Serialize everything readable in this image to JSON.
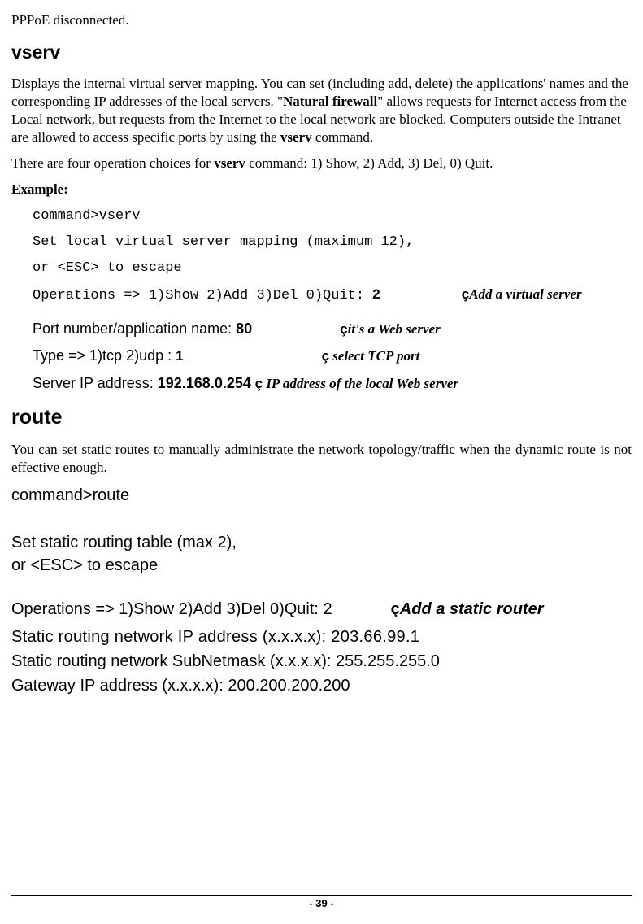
{
  "top_line": "PPPoE disconnected.",
  "vserv": {
    "heading": "vserv",
    "p1_1": "Displays the internal virtual server mapping. You can set (including add, delete) the applications' names and the corresponding IP addresses of the local servers.  \"",
    "p1_bold1": "Natural firewall",
    "p1_2": "\" allows requests for Internet access from the Local network, but requests from the Internet to the local network are blocked. Computers outside the Intranet are allowed to access specific ports by using the ",
    "p1_bold2": "vserv",
    "p1_3": " command.",
    "p2_1": "There are four operation choices for ",
    "p2_bold": "vserv",
    "p2_2": " command: 1) Show, 2) Add, 3) Del, 0) Quit.",
    "example_label": "Example:",
    "l1": "command>vserv",
    "l2": "Set local virtual server mapping (maximum 12),",
    "l3": "or <ESC> to escape",
    "l4_a": "Operations => 1)Show 2)Add 3)Del 0)Quit: ",
    "l4_b": "2",
    "l4_arrow": "ç",
    "l4_note": "Add a virtual server",
    "l5_a": "Port number/application name: ",
    "l5_b": "80",
    "l5_arrow": "ç",
    "l5_note": "it's a Web server",
    "l6_a": "Type => 1)tcp 2)udp : ",
    "l6_b": "1",
    "l6_arrow": "ç",
    "l6_note": "  select TCP port",
    "l7_a": "Server IP address: ",
    "l7_b": "192.168.0.254",
    "l7_arrow": " ç",
    "l7_note": "  IP address of the local Web server"
  },
  "route": {
    "heading": "route",
    "p1": "You can set static routes to manually administrate the network topology/traffic when the dynamic route is not effective enough.",
    "l1": "command>route",
    "l2": "Set static routing table (max 2),",
    "l3": "or <ESC> to escape",
    "l4_a": "Operations => 1)Show 2)Add 3)Del 0)Quit: 2",
    "l4_arrow": "ç",
    "l4_note": "Add a static router",
    "l5": "Static routing network IP address (x.x.x.x): 203.66.99.1",
    "l6": "Static routing network SubNetmask (x.x.x.x): 255.255.255.0",
    "l7": "Gateway IP address (x.x.x.x): 200.200.200.200"
  },
  "pagenum": "- 39 -"
}
